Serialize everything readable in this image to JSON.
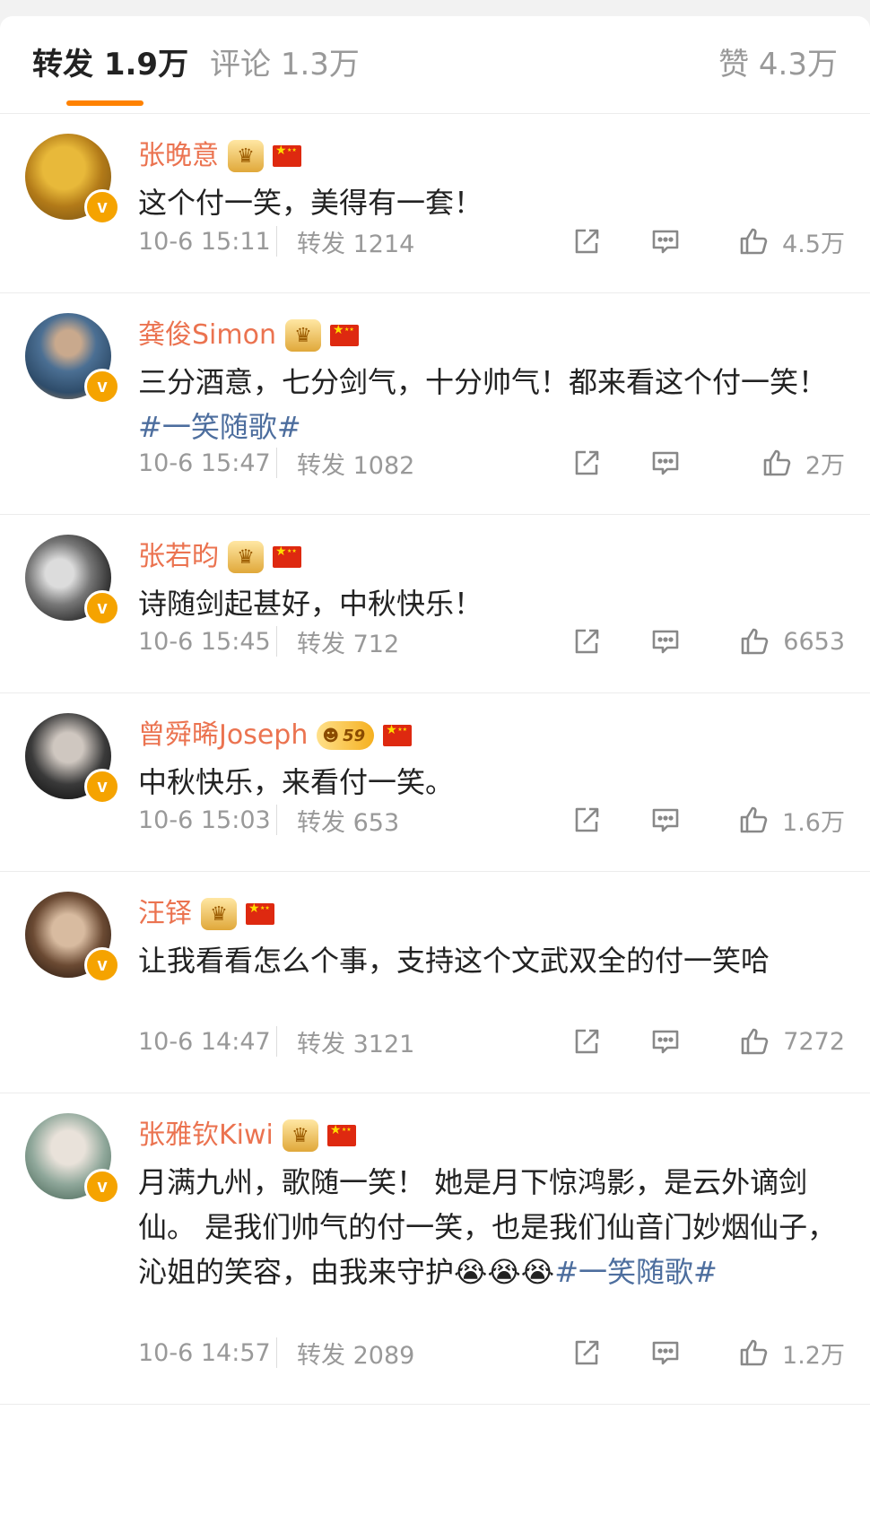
{
  "tabs": {
    "repost": {
      "label": "转发",
      "count": "1.9万"
    },
    "comment": {
      "label": "评论",
      "count": "1.3万"
    },
    "like": {
      "label": "赞",
      "count": "4.3万"
    }
  },
  "colors": {
    "accent": "#ff8200",
    "username": "#eb7350",
    "hashtag": "#4d6e9e",
    "vbadge": "#f5a300"
  },
  "reposts": [
    {
      "user": "张晚意",
      "badge": "crown",
      "text": "这个付一笑，美得有一套！",
      "hashtag": "",
      "time": "10-6 15:11",
      "repost_label": "转发",
      "repost_count": "1214",
      "likes": "4.5万"
    },
    {
      "user": "龚俊Simon",
      "badge": "crown",
      "text": "三分酒意，七分剑气，十分帅气！都来看这个付一笑！",
      "hashtag": "#一笑随歌#",
      "time": "10-6 15:47",
      "repost_label": "转发",
      "repost_count": "1082",
      "likes": "2万"
    },
    {
      "user": "张若昀",
      "badge": "crown",
      "text": "诗随剑起甚好，中秋快乐！",
      "hashtag": "",
      "time": "10-6 15:45",
      "repost_label": "转发",
      "repost_count": "712",
      "likes": "6653"
    },
    {
      "user": "曾舜晞Joseph",
      "badge": "level",
      "level": "59",
      "text": "中秋快乐，来看付一笑。",
      "hashtag": "",
      "time": "10-6 15:03",
      "repost_label": "转发",
      "repost_count": "653",
      "likes": "1.6万"
    },
    {
      "user": "汪铎",
      "badge": "crown",
      "text": "让我看看怎么个事，支持这个文武双全的付一笑哈",
      "hashtag": "",
      "time": "10-6 14:47",
      "repost_label": "转发",
      "repost_count": "3121",
      "likes": "7272"
    },
    {
      "user": "张雅钦Kiwi",
      "badge": "crown",
      "text": "月满九州，歌随一笑！ 她是月下惊鸿影，是云外谪剑仙。 是我们帅气的付一笑，也是我们仙音门妙烟仙子，沁姐的笑容，由我来守护😭😭😭",
      "hashtag": "#一笑随歌#",
      "time": "10-6 14:57",
      "repost_label": "转发",
      "repost_count": "2089",
      "likes": "1.2万"
    }
  ]
}
